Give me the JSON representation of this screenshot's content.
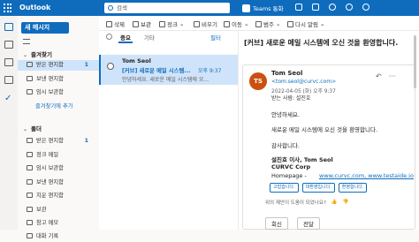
{
  "app": {
    "name": "Outlook"
  },
  "search": {
    "placeholder": "검색"
  },
  "topbar": {
    "teams_label": "Teams 통화"
  },
  "nav": {
    "new_mail": "새 메시지"
  },
  "favorites": {
    "title": "즐겨찾기",
    "items": [
      {
        "label": "받은 편지함",
        "count": "1"
      },
      {
        "label": "보낸 편지함",
        "count": ""
      },
      {
        "label": "임시 보관함",
        "count": ""
      }
    ],
    "add_link": "즐겨찾기에 추가"
  },
  "folders": {
    "title": "폴더",
    "items": [
      {
        "label": "받은 편지함",
        "count": "1"
      },
      {
        "label": "정크 메일",
        "count": ""
      },
      {
        "label": "임시 보관함",
        "count": ""
      },
      {
        "label": "보낸 편지함",
        "count": ""
      },
      {
        "label": "지운 편지함",
        "count": ""
      },
      {
        "label": "보관",
        "count": ""
      },
      {
        "label": "참고 메모",
        "count": ""
      },
      {
        "label": "대화 기록",
        "count": ""
      }
    ]
  },
  "ribbon": {
    "delete": "삭제",
    "archive": "보관",
    "junk": "정크",
    "sweep": "비우기",
    "move": "이동",
    "categorize": "범주",
    "snooze": "다시 알림"
  },
  "list": {
    "tab_focused": "중요",
    "tab_other": "기타",
    "filter": "필터",
    "messages": [
      {
        "from": "Tom Seol",
        "subject": "[커브] 새로운 메일 시스템...",
        "time": "오후 9:37",
        "preview": "안녕하세요. 새로운 메일 시스템에 오..."
      }
    ]
  },
  "reading": {
    "subject": "[커브] 새로운 메일 시스템에 오신 것을 환영합니다.",
    "avatar_initials": "TS",
    "avatar_color": "#ca5010",
    "sender_name": "Tom Seol",
    "sender_email": "<tom.seol@curvc.com>",
    "date": "2022-04-05 (화) 오후 9:37",
    "recipient": "받는 사람: 설진호",
    "body": {
      "greeting": "안녕하세요.",
      "line1": "새로운 메일 시스템에 오신 것을 환영합니다.",
      "thanks": "감사합니다.",
      "sig_name": "설진호 이사, Tom Seol",
      "sig_company": "CURVC Corp",
      "sig_homepage_label": "Homepage - ",
      "sig_homepage_links": "www.curvc.com, www.testaide.io"
    },
    "quick_replies": [
      "고맙습니다.",
      "대환영입니다.",
      "환영합니다."
    ],
    "reactions_label": "위의 제안이 도움이 되었나요?",
    "reply": "회신",
    "forward": "전달"
  },
  "colors": {
    "brand": "#0f6cbd",
    "selection": "#cfe4fa"
  }
}
